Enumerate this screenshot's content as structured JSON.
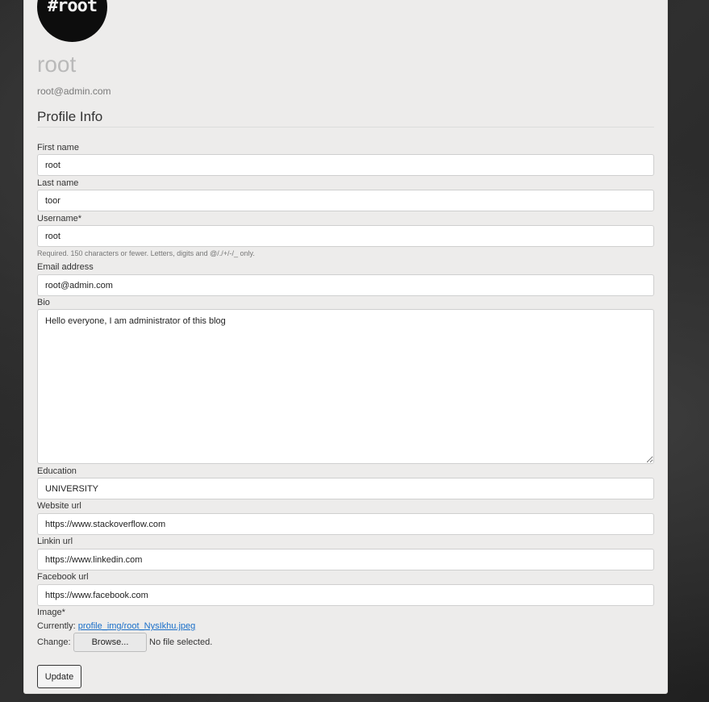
{
  "profile": {
    "avatar_text": "#root",
    "display_name": "root",
    "email": "root@admin.com"
  },
  "section_title": "Profile Info",
  "form": {
    "first_name": {
      "label": "First name",
      "value": "root"
    },
    "last_name": {
      "label": "Last name",
      "value": "toor"
    },
    "username": {
      "label": "Username*",
      "value": "root",
      "help": "Required. 150 characters or fewer. Letters, digits and @/./+/-/_ only."
    },
    "email": {
      "label": "Email address",
      "value": "root@admin.com"
    },
    "bio": {
      "label": "Bio",
      "value": "Hello everyone, I am administrator of this blog"
    },
    "education": {
      "label": "Education",
      "value": "UNIVERSITY"
    },
    "website": {
      "label": "Website url",
      "value": "https://www.stackoverflow.com"
    },
    "linkedin": {
      "label": "Linkin url",
      "value": "https://www.linkedin.com"
    },
    "facebook": {
      "label": "Facebook url",
      "value": "https://www.facebook.com"
    },
    "image": {
      "label": "Image*",
      "currently_label": "Currently:",
      "current_file": "profile_img/root_NysIkhu.jpeg",
      "change_label": "Change:",
      "browse_label": "Browse...",
      "no_file": "No file selected."
    },
    "submit_label": "Update"
  }
}
